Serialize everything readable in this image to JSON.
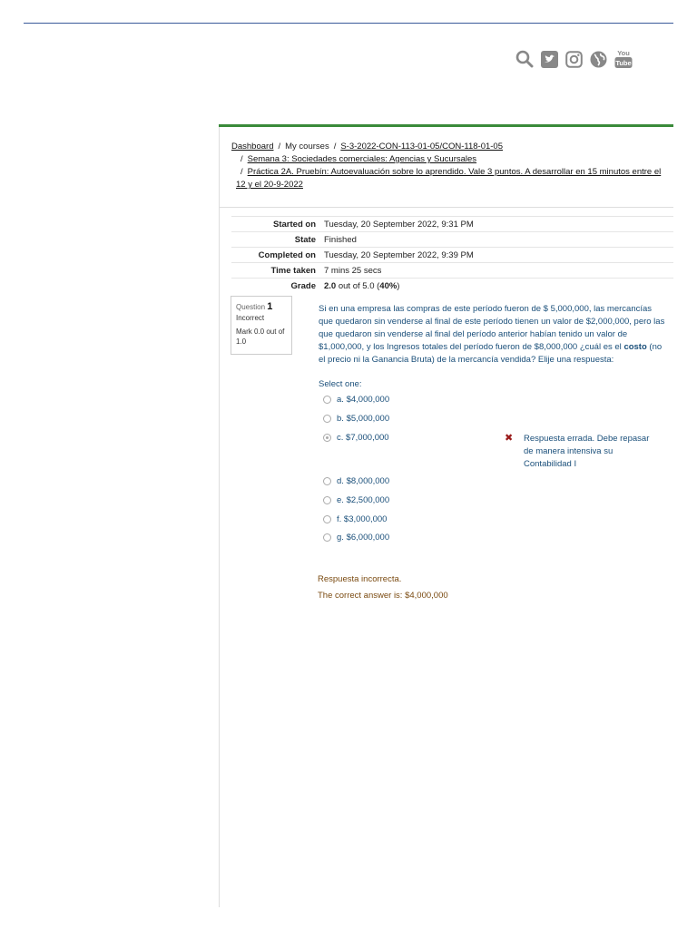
{
  "icons": [
    "search-icon",
    "twitter-icon",
    "instagram-icon",
    "globe-icon",
    "youtube-icon"
  ],
  "youtube_label_top": "You",
  "youtube_label_bottom": "Tube",
  "breadcrumb": {
    "dashboard": "Dashboard",
    "my_courses": "My courses",
    "course": "S-3-2022-CON-113-01-05/CON-118-01-05",
    "section": "Semana 3: Sociedades comerciales: Agencias y Sucursales",
    "activity_line1": "Práctica 2A. Pruebín: Autoevaluación sobre lo aprendido. Vale 3 puntos. A desarrollar en 15 minutos entre el",
    "activity_line2": "12 y el 20-9-2022",
    "separator": "/"
  },
  "summary": [
    {
      "label": "Started on",
      "value": "Tuesday, 20 September 2022, 9:31 PM"
    },
    {
      "label": "State",
      "value": "Finished"
    },
    {
      "label": "Completed on",
      "value": "Tuesday, 20 September 2022, 9:39 PM"
    },
    {
      "label": "Time taken",
      "value": "7 mins 25 secs"
    }
  ],
  "grade": {
    "label": "Grade",
    "score": "2.0",
    "out_of": " out of 5.0 (",
    "percent": "40%",
    "close": ")"
  },
  "question_info": {
    "question_word": "Question",
    "number": "1",
    "status": "Incorrect",
    "mark": "Mark 0.0 out of 1.0"
  },
  "question": {
    "text_before": "Si en una empresa las compras de este período fueron de $ 5,000,000, las mercancías que quedaron sin venderse al final de este período tienen un valor de $2,000,000, pero las que quedaron sin venderse al final del período anterior habían tenido un valor de $1,000,000, y los Ingresos totales del período fueron de $8,000,000 ¿cuál es el ",
    "bold": "costo",
    "text_after": " (no el precio ni la Ganancia Bruta) de la mercancía vendida? Elije una respuesta:",
    "select_one": "Select one:"
  },
  "answers": [
    {
      "letter": "a.",
      "text": "$4,000,000",
      "selected": false
    },
    {
      "letter": "b.",
      "text": "$5,000,000",
      "selected": false
    },
    {
      "letter": "c.",
      "text": "$7,000,000",
      "selected": true
    },
    {
      "letter": "d.",
      "text": "$8,000,000",
      "selected": false
    },
    {
      "letter": "e.",
      "text": "$2,500,000",
      "selected": false
    },
    {
      "letter": "f.",
      "text": "$3,000,000",
      "selected": false
    },
    {
      "letter": "g.",
      "text": "$6,000,000",
      "selected": false
    }
  ],
  "feedback": {
    "mark": "✖",
    "text": "Respuesta errada. Debe repasar de manera intensiva su Contabilidad I"
  },
  "outcome": {
    "general": "Respuesta incorrecta.",
    "correct_answer": "The correct answer is: $4,000,000"
  },
  "colors": {
    "accent_green": "#3a8a3a",
    "question_blue": "#1a4f7a",
    "feedback_brown": "#7a4a10",
    "incorrect_red": "#9a1a1a",
    "icon_gray": "#888888"
  }
}
